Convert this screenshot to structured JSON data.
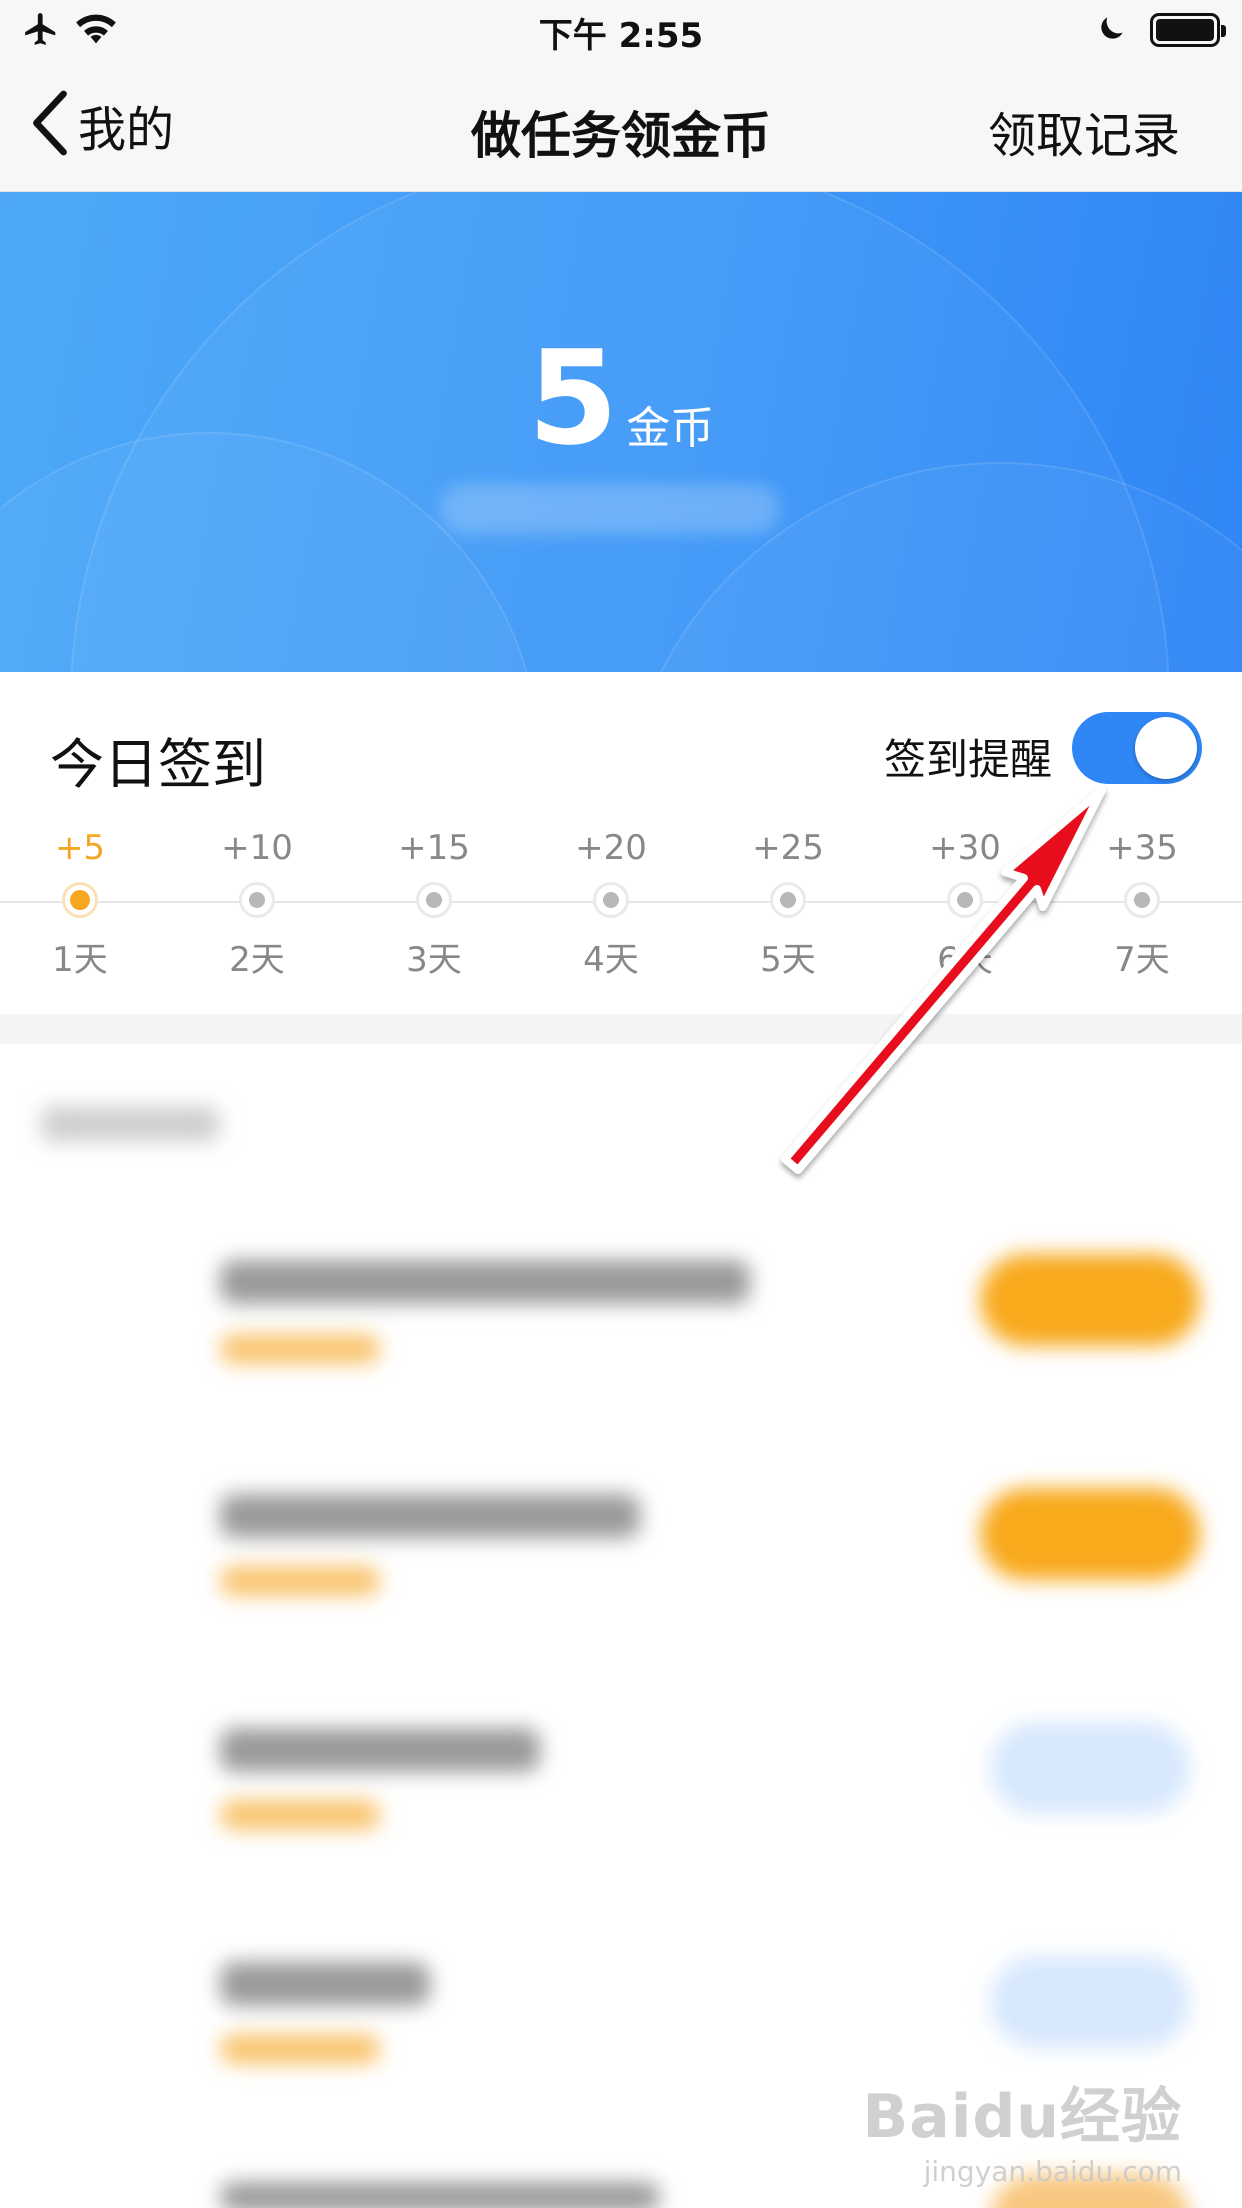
{
  "status_bar": {
    "time": "下午 2:55",
    "left_icons": [
      "airplane-icon",
      "wifi-icon"
    ],
    "right_icons": [
      "moon-icon",
      "battery-icon"
    ]
  },
  "nav": {
    "back_label": "我的",
    "title": "做任务领金币",
    "right_action": "领取记录"
  },
  "banner": {
    "coin_value": "5",
    "coin_unit": "金币"
  },
  "signin": {
    "title": "今日签到",
    "reminder_label": "签到提醒",
    "reminder_enabled": true,
    "days": [
      {
        "reward": "+5",
        "label": "1天",
        "active": true
      },
      {
        "reward": "+10",
        "label": "2天",
        "active": false
      },
      {
        "reward": "+15",
        "label": "3天",
        "active": false
      },
      {
        "reward": "+20",
        "label": "4天",
        "active": false
      },
      {
        "reward": "+25",
        "label": "5天",
        "active": false
      },
      {
        "reward": "+30",
        "label": "6天",
        "active": false
      },
      {
        "reward": "+35",
        "label": "7天",
        "active": false
      }
    ]
  },
  "colors": {
    "accent_blue": "#2f86f5",
    "accent_orange": "#f5a623",
    "arrow_red": "#e8101a"
  },
  "watermark": {
    "logo": "Baidu经验",
    "url": "jingyan.baidu.com"
  }
}
